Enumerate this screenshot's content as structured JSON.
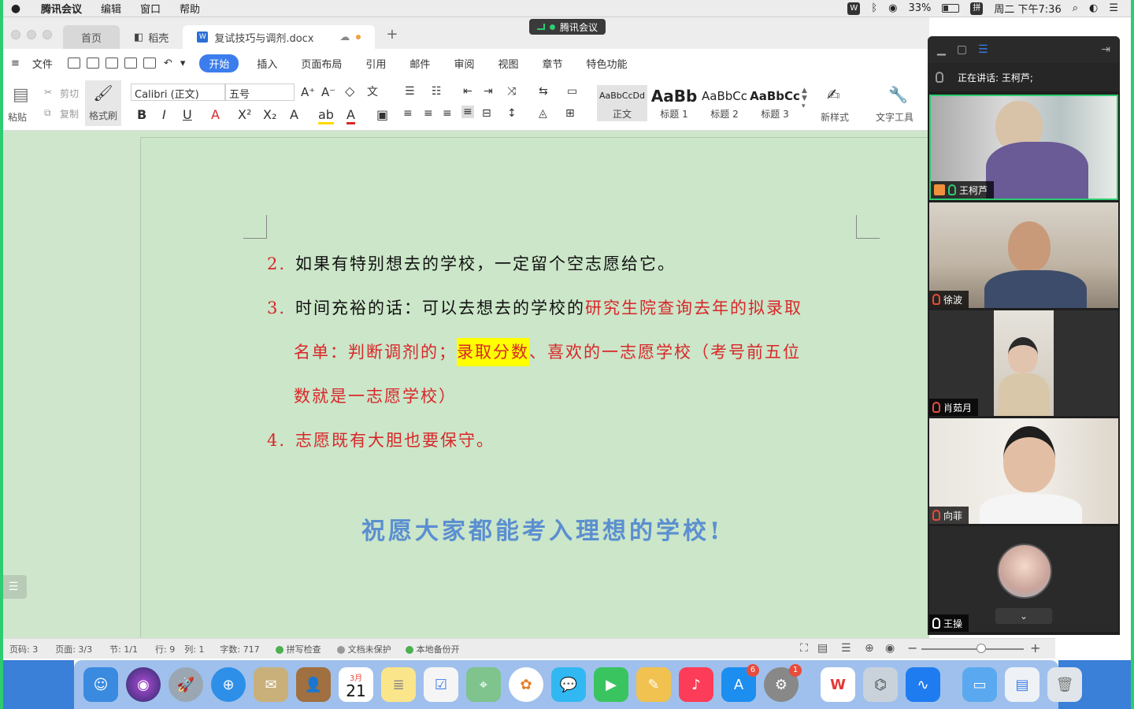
{
  "menubar": {
    "app": "腾讯会议",
    "items": [
      "编辑",
      "窗口",
      "帮助"
    ],
    "battery": "33%",
    "input": "拼",
    "clock": "周二 下午7:36"
  },
  "tabs": {
    "home": "首页",
    "daoke": "稻壳",
    "doc": "复试技巧与调剂.docx",
    "meeting_pill": "腾讯会议"
  },
  "ribbon_menu": {
    "file": "文件",
    "items": [
      "开始",
      "插入",
      "页面布局",
      "引用",
      "邮件",
      "审阅",
      "视图",
      "章节",
      "特色功能"
    ]
  },
  "ribbon": {
    "paste": "粘贴",
    "cut": "剪切",
    "copy": "复制",
    "format_painter": "格式刷",
    "font": "Calibri (正文)",
    "size": "五号",
    "styles": [
      {
        "preview": "AaBbCcDd",
        "name": "正文"
      },
      {
        "preview": "AaBb",
        "name": "标题 1"
      },
      {
        "preview": "AaBbCc",
        "name": "标题 2"
      },
      {
        "preview": "AaBbCc",
        "name": "标题 3"
      }
    ],
    "new_style": "新样式",
    "text_tools": "文字工具"
  },
  "document": {
    "p2_num": "2.",
    "p2_text": "如果有特别想去的学校，一定留个空志愿给它。",
    "p3_num": "3.",
    "p3_black": "时间充裕的话：可以去想去的学校的",
    "p3_red1": "研究生院查询去年的拟录取",
    "p3_red2": "名单：判断调剂的；",
    "p3_highlight": "录取分数",
    "p3_red3": "、喜欢的一志愿学校（考号前五位",
    "p3_red4": "数就是一志愿学校）",
    "p4_num": "4.",
    "p4_text": "志愿既有大胆也要保守。",
    "wish": "祝愿大家都能考入理想的学校!"
  },
  "status": {
    "page_code": "页码: 3",
    "pages": "页面: 3/3",
    "section": "节: 1/1",
    "row": "行: 9",
    "col": "列: 1",
    "words": "字数: 717",
    "spell": "拼写检查",
    "protect": "文档未保护",
    "backup": "本地备份开"
  },
  "meeting": {
    "speaking": "正在讲话: 王柯芦;",
    "participants": [
      "王柯芦",
      "徐波",
      "肖茹月",
      "向菲",
      "王操"
    ]
  },
  "dock": {
    "calendar_month": "3月",
    "calendar_day": "21",
    "appstore_badge": "6",
    "settings_badge": "1"
  }
}
